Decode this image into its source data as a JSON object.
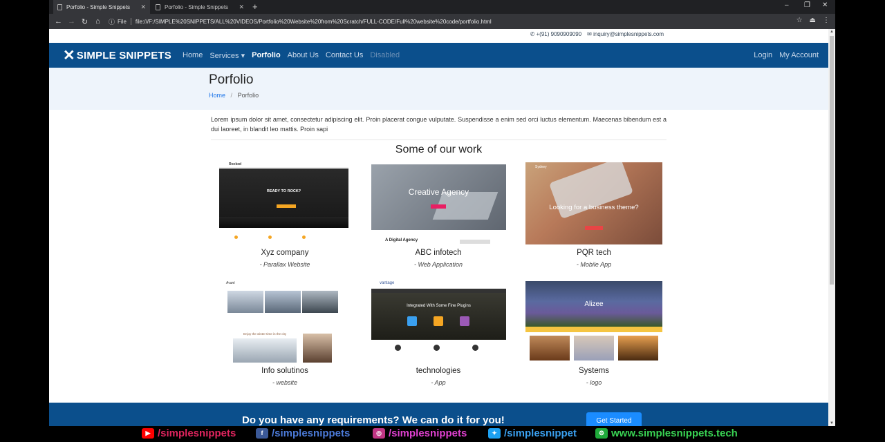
{
  "browser": {
    "tabs": [
      {
        "title": "Porfolio - Simple Snippets",
        "active": true
      },
      {
        "title": "Porfolio - Simple Snippets",
        "active": false
      }
    ],
    "new_tab": "+",
    "controls": {
      "minimize": "–",
      "restore": "❐",
      "close": "✕"
    },
    "nav": {
      "back": "←",
      "forward": "→",
      "reload": "↻",
      "home": "⌂"
    },
    "info_label": "File",
    "url": "file:///F:/SIMPLE%20SNIPPETS/ALL%20VIDEOS/Portfolio%20Website%20from%20Scratch/FULL-CODE/Full%20website%20code/portfolio.html"
  },
  "topbar": {
    "phone": "+(91) 9090909090",
    "email": "inquiry@simplesnippets.com"
  },
  "navbar": {
    "brand": "SIMPLE SNIPPETS",
    "links": [
      {
        "label": "Home",
        "state": "normal"
      },
      {
        "label": "Services ▾",
        "state": "normal"
      },
      {
        "label": "Porfolio",
        "state": "active"
      },
      {
        "label": "About Us",
        "state": "normal"
      },
      {
        "label": "Contact Us",
        "state": "normal"
      },
      {
        "label": "Disabled",
        "state": "disabled"
      }
    ],
    "right": [
      "Login",
      "My Account"
    ],
    "color": "#0b4f8c"
  },
  "header": {
    "title": "Porfolio",
    "breadcrumb": {
      "home": "Home",
      "separator": "/",
      "current": "Porfolio"
    }
  },
  "intro": "Lorem ipsum dolor sit amet, consectetur adipiscing elit. Proin placerat congue vulputate. Suspendisse a enim sed orci luctus elementum. Maecenas bibendum est a dui laoreet, in blandit leo mattis. Proin sapi",
  "section_title": "Some of our work",
  "works": [
    {
      "name": "Xyz company",
      "sub": "- Parallax Website",
      "thumb_title": "READY TO ROCK?",
      "thumb_brand": "Rocked"
    },
    {
      "name": "ABC infotech",
      "sub": "- Web Application",
      "thumb_title": "Creative Agency",
      "thumb_brand": "A Digital Agency"
    },
    {
      "name": "PQR tech",
      "sub": "- Mobile App",
      "thumb_title": "Looking for a business theme?",
      "thumb_brand": "Sydney"
    },
    {
      "name": "Info solutinos",
      "sub": "- website",
      "thumb_title": "Enjoy the winter time in the city",
      "thumb_brand": "Avant"
    },
    {
      "name": "technologies",
      "sub": "- App",
      "thumb_title": "Integrated With Some Fine Plugins",
      "thumb_brand": "vantage"
    },
    {
      "name": "Systems",
      "sub": "- logo",
      "thumb_title": "Alizee",
      "thumb_brand": ""
    }
  ],
  "cta": {
    "text": "Do you have any requirements? We can do it for you!",
    "button": "Get Started"
  },
  "social": [
    {
      "icon": "youtube-icon",
      "label": "/simplesnippets",
      "color": "#e0245e",
      "icon_color": "#ff0000"
    },
    {
      "icon": "facebook-icon",
      "label": "/simplesnippets",
      "color": "#4c7bd9",
      "icon_color": "#3b5998"
    },
    {
      "icon": "instagram-icon",
      "label": "/simplesnippets",
      "color": "#e040d0",
      "icon_color": "#c13584"
    },
    {
      "icon": "twitter-icon",
      "label": "/simplesnippet",
      "color": "#3aa0f0",
      "icon_color": "#1da1f2"
    },
    {
      "icon": "web-icon",
      "label": "www.simplesnippets.tech",
      "color": "#39d353",
      "icon_color": "#1faa3a"
    }
  ]
}
